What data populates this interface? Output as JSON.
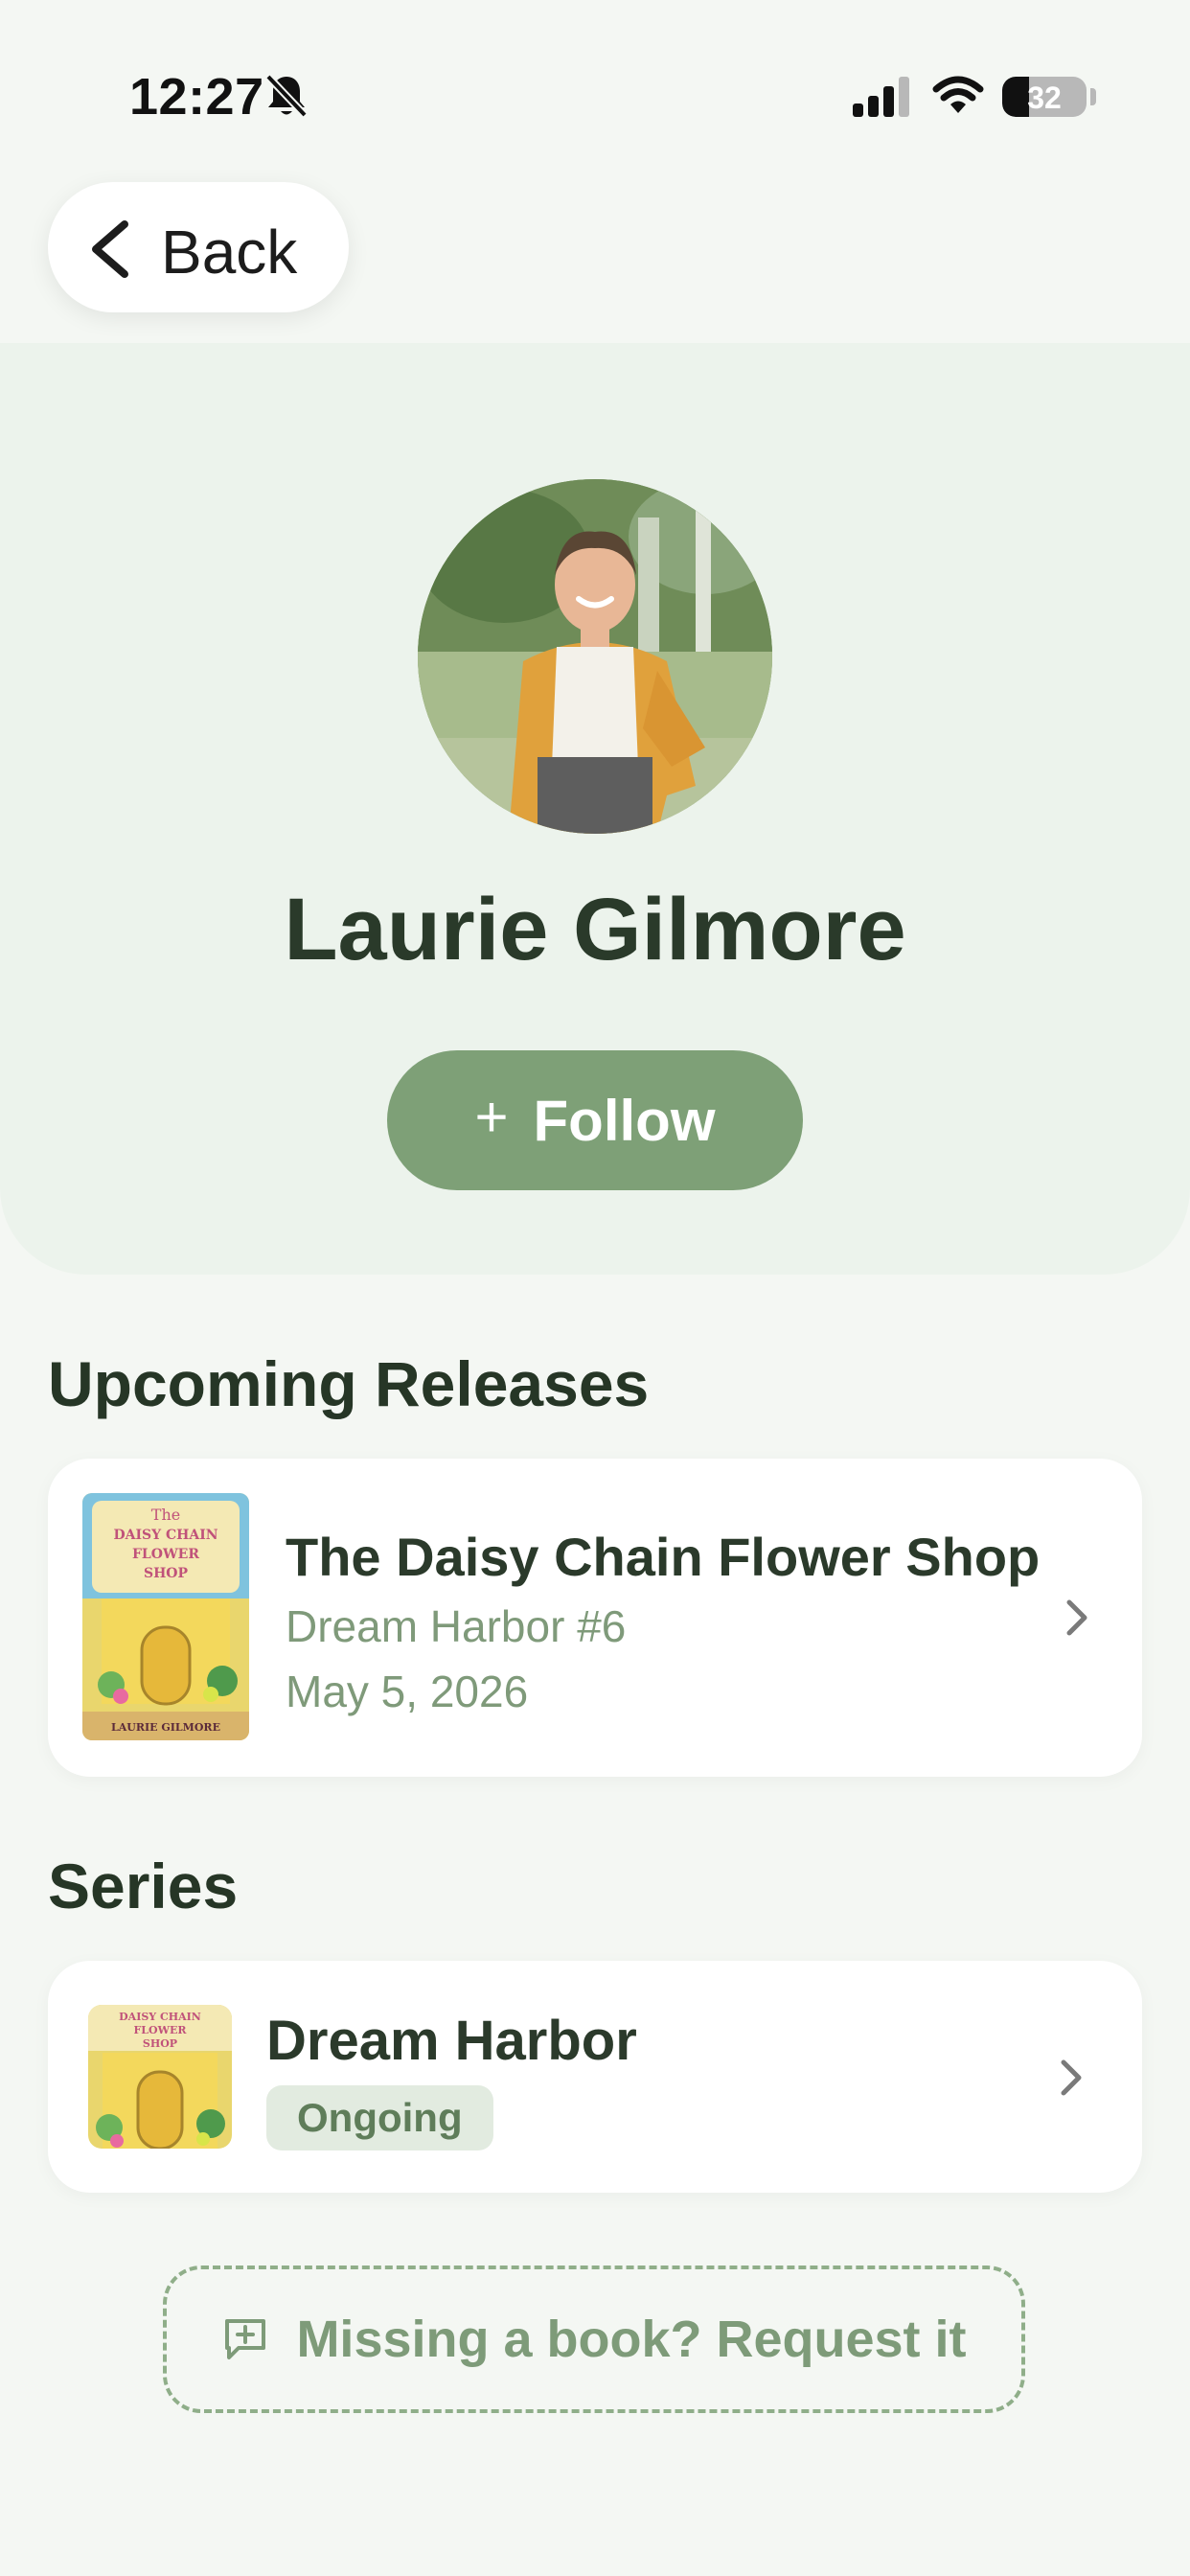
{
  "status_bar": {
    "time": "12:27",
    "battery_level": 32,
    "battery_text": "32",
    "icons": [
      "bell-slash-icon",
      "cellular-signal-icon",
      "wifi-icon",
      "battery-icon"
    ]
  },
  "nav": {
    "back_label": "Back",
    "back_icon": "chevron-left-icon"
  },
  "author": {
    "name": "Laurie Gilmore",
    "follow_icon": "plus-icon",
    "follow_label": "Follow"
  },
  "upcoming": {
    "heading": "Upcoming Releases",
    "items": [
      {
        "title": "The Daisy Chain Flower Shop",
        "series": "Dream Harbor #6",
        "date": "May 5, 2026",
        "cover_text": {
          "top": "The",
          "main": "DAISY CHAIN FLOWER SHOP",
          "author": "LAURIE GILMORE"
        }
      }
    ]
  },
  "series": {
    "heading": "Series",
    "items": [
      {
        "name": "Dream Harbor",
        "status": "Ongoing",
        "cover_text": "DAISY CHAIN FLOWER SHOP"
      }
    ]
  },
  "request": {
    "icon": "message-plus-icon",
    "label": "Missing a book? Request it"
  },
  "colors": {
    "background": "#f4f7f3",
    "hero_bg": "#ecf3ec",
    "accent": "#7ea077",
    "text_dark": "#2b3a2b",
    "text_muted": "#7f9a7a",
    "badge_bg": "#e2ebe0"
  }
}
